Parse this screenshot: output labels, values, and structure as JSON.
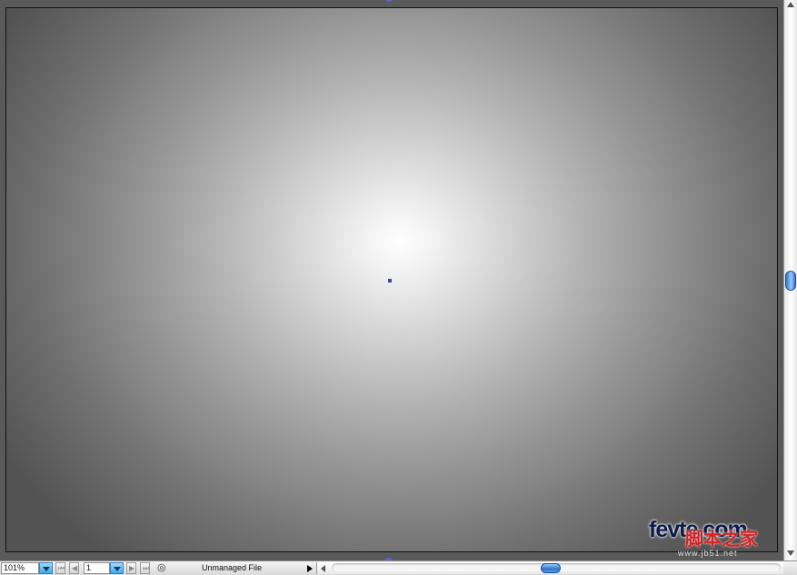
{
  "statusbar": {
    "zoom": "101%",
    "page": "1",
    "status_text": "Unmanaged File",
    "first_icon": "first-page-icon",
    "prev_icon": "previous-page-icon",
    "next_icon": "next-page-icon",
    "last_icon": "last-page-icon"
  },
  "watermark": {
    "logo": "fevte.com",
    "chinese": "脚本之家",
    "url": "www.jb51.net"
  },
  "colors": {
    "selection": "#3a44b8",
    "scroll_thumb": "#2f74d0",
    "dropdown": "#3aa9ee"
  }
}
